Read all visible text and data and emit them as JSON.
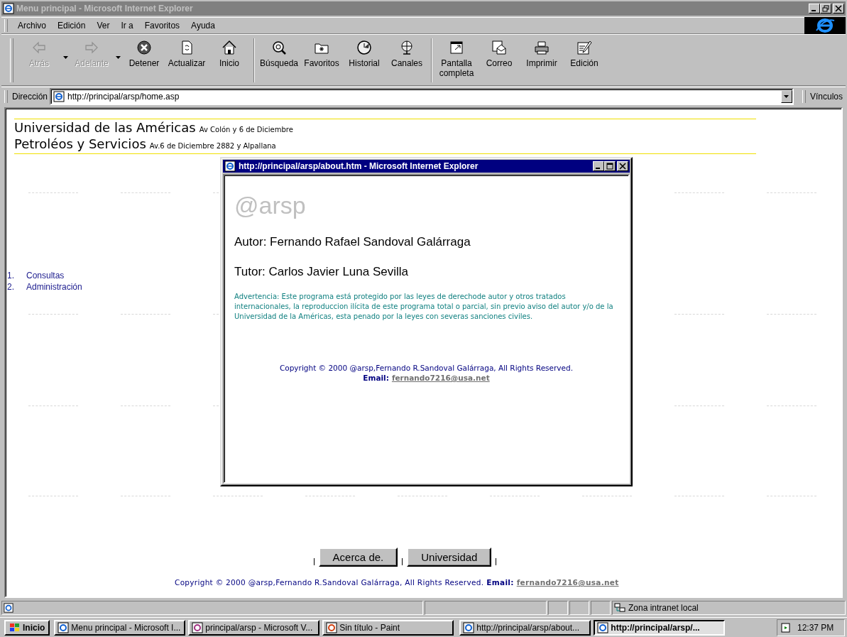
{
  "window": {
    "title": "Menu principal - Microsoft Internet Explorer",
    "active": false
  },
  "menu": [
    "Archivo",
    "Edición",
    "Ver",
    "Ir a",
    "Favoritos",
    "Ayuda"
  ],
  "toolbar": [
    {
      "label": "Atrás",
      "disabled": true,
      "dropdown": true
    },
    {
      "label": "Adelante",
      "disabled": true,
      "dropdown": true
    },
    {
      "label": "Detener",
      "disabled": false,
      "dropdown": false
    },
    {
      "label": "Actualizar",
      "disabled": false,
      "dropdown": false
    },
    {
      "label": "Inicio",
      "disabled": false,
      "dropdown": false
    },
    {
      "label": "Búsqueda",
      "disabled": false,
      "dropdown": false
    },
    {
      "label": "Favoritos",
      "disabled": false,
      "dropdown": false
    },
    {
      "label": "Historial",
      "disabled": false,
      "dropdown": false
    },
    {
      "label": "Canales",
      "disabled": false,
      "dropdown": false
    },
    {
      "label": "Pantalla completa",
      "disabled": false,
      "dropdown": false
    },
    {
      "label": "Correo",
      "disabled": false,
      "dropdown": false
    },
    {
      "label": "Imprimir",
      "disabled": false,
      "dropdown": false
    },
    {
      "label": "Edición",
      "disabled": false,
      "dropdown": false
    }
  ],
  "address": {
    "label": "Dirección",
    "value": "http://principal/arsp/home.asp",
    "links": "Vínculos"
  },
  "page": {
    "header": [
      {
        "title": "Universidad de las Américas",
        "address": "Av Colón y 6 de Diciembre"
      },
      {
        "title": "Petroléos y Servicios",
        "address": "Av.6 de Diciembre 2882 y Alpallana"
      }
    ],
    "menu_list": [
      {
        "number": "1.",
        "label": "Consultas"
      },
      {
        "number": "2.",
        "label": "Administración"
      }
    ],
    "buttons": [
      "Acerca de.",
      "Universidad"
    ],
    "copyright": "Copyright © 2000 @arsp,Fernando R.Sandoval Galárraga, All Rights Reserved.",
    "email_label": "Email:",
    "email": "fernando7216@usa.net"
  },
  "popup": {
    "title": "http://principal/arsp/about.htm - Microsoft Internet Explorer",
    "active": true,
    "logo": "@arsp",
    "author": "Autor: Fernando Rafael Sandoval Galárraga",
    "tutor": "Tutor: Carlos Javier Luna Sevilla",
    "warning": "Advertencia: Este programa está protegido por las leyes de derechode autor y otros tratados internacionales, la reproduccion ilícita de este programa total o parcial, sin previo aviso del autor y/o de la Universidad de la Américas, esta penado por la leyes con severas sanciones civiles.",
    "copyright": "Copyright © 2000 @arsp,Fernando R.Sandoval Galárraga, All Rights Reserved.",
    "email_label": "Email:",
    "email": "fernando7216@usa.net"
  },
  "status_bar": {
    "zone": "Zona intranet local"
  },
  "taskbar": {
    "start": "Inicio",
    "tasks": [
      {
        "label": "Menu principal - Microsoft I...",
        "selected": false
      },
      {
        "label": "principal/arsp - Microsoft V...",
        "selected": false
      },
      {
        "label": "Sin título - Paint",
        "selected": false
      },
      {
        "label": "http://principal/arsp/about...",
        "selected": false
      },
      {
        "label": "http://principal/arsp/...",
        "selected": true
      }
    ],
    "clock": "12:37 PM"
  }
}
